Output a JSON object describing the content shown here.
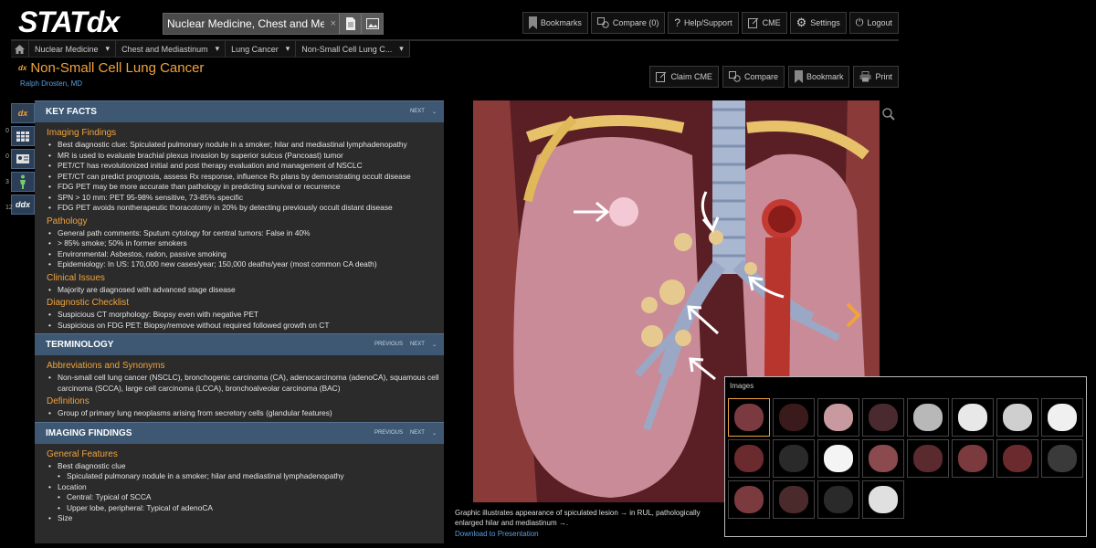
{
  "app": {
    "logo": "STATdx"
  },
  "search": {
    "value": "Nuclear Medicine, Chest and Mediasti",
    "clear": "×"
  },
  "toolbar": {
    "bookmarks": "Bookmarks",
    "compare": "Compare (0)",
    "help": "Help/Support",
    "cme": "CME",
    "settings": "Settings",
    "logout": "Logout"
  },
  "breadcrumb": [
    {
      "label": "Nuclear Medicine"
    },
    {
      "label": "Chest and Mediastinum"
    },
    {
      "label": "Lung Cancer"
    },
    {
      "label": "Non-Small Cell Lung C..."
    }
  ],
  "page": {
    "badge": "dx",
    "title": "Non-Small Cell Lung Cancer",
    "author": "Ralph Drosten, MD"
  },
  "title_actions": {
    "claim_cme": "Claim CME",
    "compare": "Compare",
    "bookmark": "Bookmark",
    "print": "Print"
  },
  "rail": [
    {
      "label": "dx",
      "count": ""
    },
    {
      "label": "",
      "count": "0"
    },
    {
      "label": "",
      "count": "0"
    },
    {
      "label": "",
      "count": "3"
    },
    {
      "label": "ddx",
      "count": "12"
    }
  ],
  "sections": {
    "key_facts": {
      "title": "KEY FACTS",
      "nav_next": "NEXT",
      "groups": [
        {
          "heading": "Imaging Findings",
          "items": [
            "Best diagnostic clue: Spiculated pulmonary nodule in a smoker; hilar and mediastinal lymphadenopathy",
            "MR is used to evaluate brachial plexus invasion by superior sulcus (Pancoast) tumor",
            "PET/CT has revolutionized initial and post therapy evaluation and management of NSCLC",
            "PET/CT can predict prognosis, assess Rx response, influence Rx plans by demonstrating occult disease",
            "FDG PET may be more accurate than pathology in predicting survival or recurrence",
            "SPN > 10 mm: PET 95-98% sensitive, 73-85% specific",
            "FDG PET avoids nontherapeutic thoracotomy in 20% by detecting previously occult distant disease"
          ]
        },
        {
          "heading": "Pathology",
          "items": [
            "General path comments: Sputum cytology for central tumors: False in 40%",
            "> 85% smoke; 50% in former smokers",
            "Environmental: Asbestos, radon, passive smoking",
            "Epidemiology: In US: 170,000 new cases/year; 150,000 deaths/year (most common CA death)"
          ]
        },
        {
          "heading": "Clinical Issues",
          "items": [
            "Majority are diagnosed with advanced stage disease"
          ]
        },
        {
          "heading": "Diagnostic Checklist",
          "items": [
            "Suspicious CT morphology: Biopsy even with negative PET",
            "Suspicious on FDG PET: Biopsy/remove without required followed growth on CT"
          ]
        }
      ]
    },
    "terminology": {
      "title": "TERMINOLOGY",
      "nav_prev": "PREVIOUS",
      "nav_next": "NEXT",
      "groups": [
        {
          "heading": "Abbreviations and Synonyms",
          "items": [
            "Non-small cell lung cancer (NSCLC), bronchogenic carcinoma (CA), adenocarcinoma (adenoCA), squamous cell carcinoma (SCCA), large cell carcinoma (LCCA), bronchoalveolar carcinoma (BAC)"
          ]
        },
        {
          "heading": "Definitions",
          "items": [
            "Group of primary lung neoplasms arising from secretory cells (glandular features)"
          ]
        }
      ]
    },
    "imaging": {
      "title": "IMAGING FINDINGS",
      "nav_prev": "PREVIOUS",
      "nav_next": "NEXT",
      "heading": "General Features",
      "items": [
        {
          "text": "Best diagnostic clue",
          "level": 1
        },
        {
          "text": "Spiculated pulmonary nodule in a smoker; hilar and mediastinal lymphadenopathy",
          "level": 2
        },
        {
          "text": "Location",
          "level": 1
        },
        {
          "text": "Central: Typical of SCCA",
          "level": 2
        },
        {
          "text": "Upper lobe, peripheral: Typical of adenoCA",
          "level": 2
        },
        {
          "text": "Size",
          "level": 1
        }
      ]
    }
  },
  "viewer": {
    "caption": "Graphic illustrates appearance of spiculated lesion → in RUL, pathologically enlarged hilar and mediastinum →.",
    "download": "Download to Presentation"
  },
  "thumbnails": {
    "title": "Images",
    "colors": [
      "#7a3a40",
      "#3a1a1a",
      "#c89aa0",
      "#4a2a2e",
      "#b8b8b8",
      "#e8e8e8",
      "#cfcfcf",
      "#f0f0f0",
      "#6a2a2e",
      "#2a2a2a",
      "#f4f4f4",
      "#8a4a4e",
      "#5a2a2e",
      "#7a3a3e",
      "#6a2a2e",
      "#3a3a3a",
      "#7a3a3e",
      "#4a2a2a",
      "#2a2a2a",
      "#e0e0e0"
    ]
  },
  "colors": {
    "accent": "#f0a33c",
    "link": "#5c9de0",
    "section": "#3e5874"
  }
}
